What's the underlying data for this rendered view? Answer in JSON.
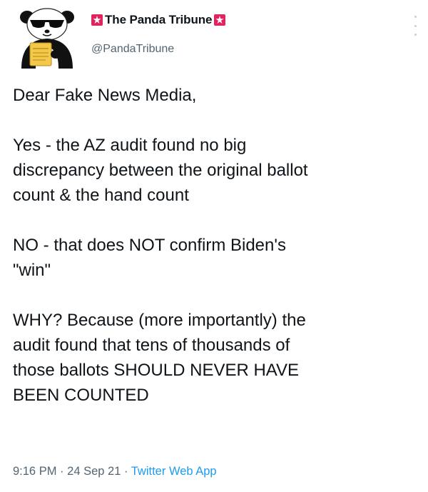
{
  "account": {
    "display_name": "The Panda Tribune",
    "handle": "@PandaTribune",
    "name_emoji": "siren-icon",
    "avatar": "panda-avatar-icon"
  },
  "tweet": {
    "paragraphs": [
      "Dear Fake News Media,",
      "Yes - the AZ audit found no big discrepancy between the original ballot count & the hand count",
      "NO - that does NOT confirm Biden's \"win\"",
      "WHY? Because (more importantly) the audit found that tens of thousands of those ballots SHOULD NEVER HAVE BEEN COUNTED"
    ],
    "lines": {
      "p1": [
        "Dear Fake News Media,"
      ],
      "p2": [
        "Yes - the AZ audit found no big",
        "discrepancy between the original ballot",
        "count & the hand count"
      ],
      "p3": [
        "NO - that does NOT confirm Biden's",
        "\"win\""
      ],
      "p4": [
        "WHY? Because (more importantly) the",
        "audit found that tens of thousands of",
        "those ballots SHOULD NEVER HAVE",
        "BEEN COUNTED"
      ]
    }
  },
  "meta": {
    "time": "9:16 PM",
    "separator": "·",
    "date": "24 Sep 21",
    "source": "Twitter Web App"
  },
  "colors": {
    "text": "#0f1419",
    "secondary": "#536471",
    "link": "#1d9bf0",
    "siren": "#e0245e"
  }
}
